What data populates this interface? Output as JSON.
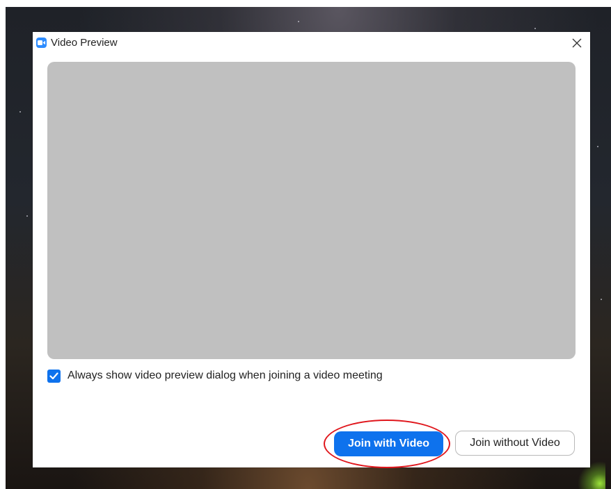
{
  "window": {
    "title": "Video Preview",
    "app_icon": "zoom-camera-icon",
    "close_icon": "close-icon"
  },
  "preview": {
    "state": "no-video"
  },
  "options": {
    "always_show_preview_label": "Always show video preview dialog when joining a video meeting",
    "always_show_preview_checked": true
  },
  "actions": {
    "join_with_video_label": "Join with Video",
    "join_without_video_label": "Join without Video"
  },
  "colors": {
    "accent": "#0e72ed",
    "app_icon": "#2d8cff",
    "preview_bg": "#c0c0c0",
    "annotation": "#e0161c"
  }
}
